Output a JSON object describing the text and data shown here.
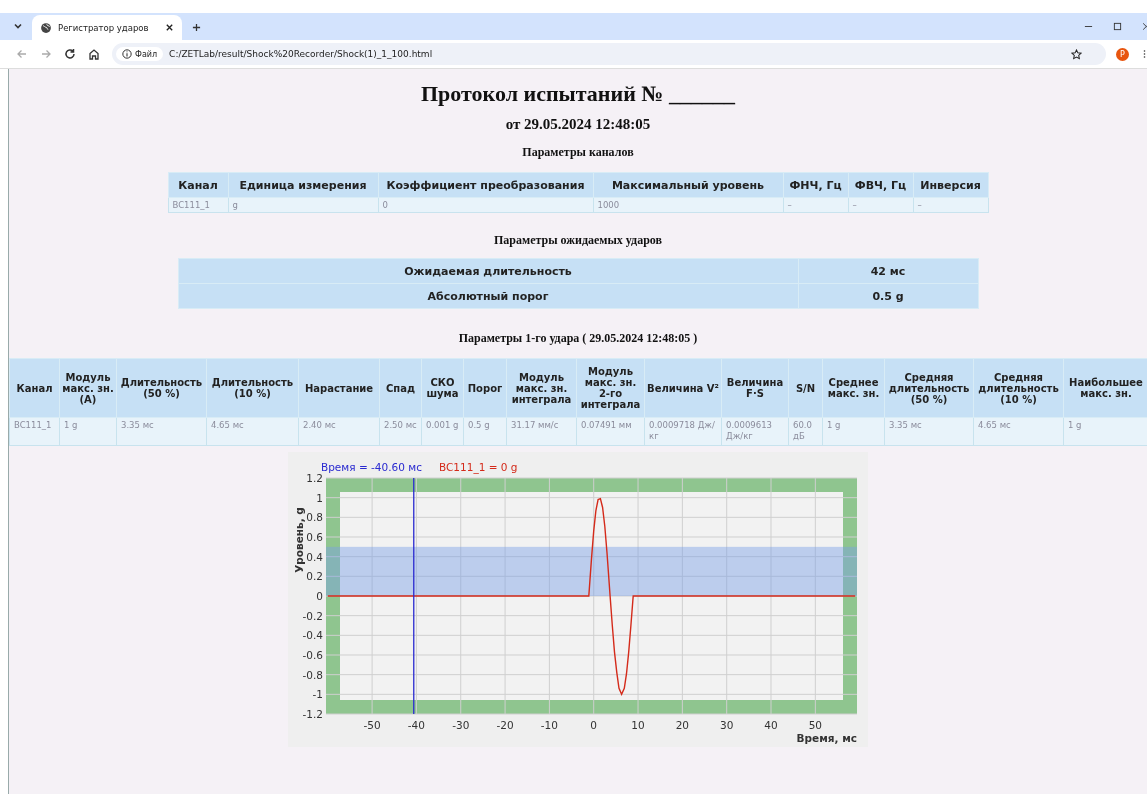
{
  "browser": {
    "tab": {
      "title": "Регистратор ударов",
      "selected": true
    },
    "address": {
      "chip": "Файл",
      "url": "C:/ZETLab/result/Shock%20Recorder/Shock(1)_1_100.html"
    },
    "profile": "P"
  },
  "title": "Протокол испытаний № ______",
  "subtitle": "от 29.05.2024 12:48:05",
  "channels": {
    "heading": "Параметры каналов",
    "columns": [
      "Канал",
      "Единица измерения",
      "Коэффициент преобразования",
      "Максимальный уровень",
      "ФНЧ, Гц",
      "ФВЧ, Гц",
      "Инверсия"
    ],
    "rows": [
      [
        "BC111_1",
        "g",
        "0",
        "1000",
        "–",
        "–",
        "–"
      ]
    ]
  },
  "expected": {
    "heading": "Параметры ожидаемых ударов",
    "rows": [
      {
        "label": "Ожидаемая длительность",
        "value": "42 мс"
      },
      {
        "label": "Абсолютный порог",
        "value": "0.5 g"
      }
    ]
  },
  "shock": {
    "heading": "Параметры 1-го удара ( 29.05.2024 12:48:05 )",
    "columns": [
      "Канал",
      "Модуль макс. зн. (А)",
      "Длительность (50 %)",
      "Длительность (10 %)",
      "Нарастание",
      "Спад",
      "СКО шума",
      "Порог",
      "Модуль макс. зн. интеграла",
      "Модуль макс. зн. 2-го интеграла",
      "Величина V²",
      "Величина F·S",
      "S/N",
      "Среднее макс. зн.",
      "Средняя длительность (50 %)",
      "Средняя длительность (10 %)",
      "Наибольшее макс. зн."
    ],
    "rows": [
      [
        "BC111_1",
        "1 g",
        "3.35 мс",
        "4.65 мс",
        "2.40 мс",
        "2.50 мс",
        "0.001 g",
        "0.5 g",
        "31.17 мм/с",
        "0.07491 мм",
        "0.0009718 Дж/кг",
        "0.0009613 Дж/кг",
        "60.0 дБ",
        "1 g",
        "3.35 мс",
        "4.65 мс",
        "1 g"
      ]
    ]
  },
  "chart": {
    "chart_data": {
      "type": "line",
      "xlabel": "Время, мс",
      "ylabel": "Уровень, g",
      "x": [
        -60,
        -1.1,
        -0.5,
        0,
        0.5,
        1,
        1.5,
        2,
        2.5,
        3,
        3.7,
        4.2,
        4.7,
        5.2,
        5.7,
        6.3,
        6.9,
        7.4,
        7.9,
        8.4,
        8.9,
        59
      ],
      "series": [
        {
          "name": "BC111_1",
          "color": "#d42a1a",
          "values": [
            0,
            0,
            0.38,
            0.66,
            0.87,
            0.98,
            0.99,
            0.9,
            0.71,
            0.44,
            0,
            -0.3,
            -0.57,
            -0.78,
            -0.94,
            -1,
            -0.94,
            -0.79,
            -0.57,
            -0.3,
            0,
            0
          ]
        }
      ],
      "xlim": [
        -60.4,
        59.4
      ],
      "ylim": [
        -1.2,
        1.2
      ],
      "xticks": [
        -50,
        -40,
        -30,
        -20,
        -10,
        0,
        10,
        20,
        30,
        40,
        50
      ],
      "yticks": [
        -1.2,
        -1,
        -0.8,
        -0.6,
        -0.4,
        -0.2,
        0,
        0.2,
        0.4,
        0.6,
        0.8,
        1,
        1.2
      ],
      "grid": true,
      "bands": [
        {
          "axis": "y",
          "from": 0,
          "to": 0.5,
          "color": "#7aa0e6"
        }
      ],
      "ref_lines": [
        {
          "axis": "x",
          "value": -40.6,
          "color": "#2a2ad0"
        }
      ],
      "annotations": [
        {
          "text": "Время = -40.60 мс"
        },
        {
          "text": "= 0 g"
        }
      ]
    }
  }
}
